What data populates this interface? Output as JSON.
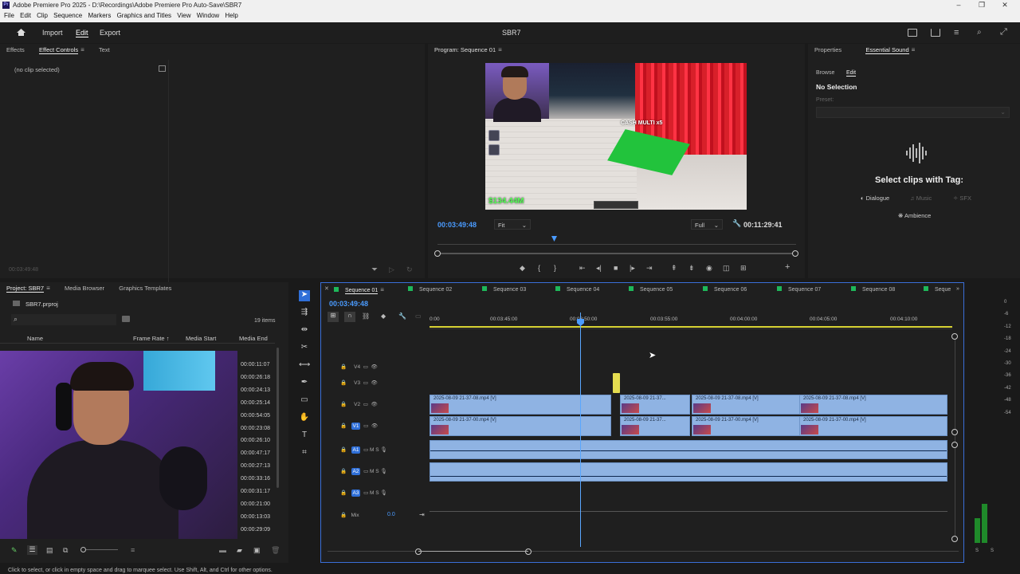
{
  "window": {
    "title": "Adobe Premiere Pro 2025 - D:\\Recordings\\Adobe Premiere Pro Auto-Save\\SBR7",
    "logo_text": "Pr"
  },
  "menu": [
    "File",
    "Edit",
    "Clip",
    "Sequence",
    "Markers",
    "Graphics and Titles",
    "View",
    "Window",
    "Help"
  ],
  "appbar": {
    "import": "Import",
    "edit": "Edit",
    "export": "Export",
    "project_title": "SBR7"
  },
  "effects_panel": {
    "tabs": [
      "Effects",
      "Effect Controls",
      "Text"
    ],
    "no_clip": "(no clip selected)",
    "timecode": "00:03:49:48"
  },
  "program": {
    "title": "Program: Sequence 01",
    "current_tc": "00:03:49:48",
    "fit": "Fit",
    "quality": "Full",
    "duration_tc": "00:11:29:41",
    "overlay_money": "$134.44M",
    "overlay_cash": "CASH MULTI x5"
  },
  "essential_sound": {
    "tabs": [
      "Properties",
      "Essential Sound"
    ],
    "subtabs": [
      "Browse",
      "Edit"
    ],
    "no_selection": "No Selection",
    "preset_label": "Preset:",
    "select_tag": "Select clips with Tag:",
    "tags": [
      "Dialogue",
      "Music",
      "SFX",
      "Ambience"
    ]
  },
  "project": {
    "tabs": [
      "Project: SBR7",
      "Media Browser",
      "Graphics Templates"
    ],
    "file": "SBR7.prproj",
    "items": "19 items",
    "columns": [
      "Name",
      "Frame Rate",
      "Media Start",
      "Media End"
    ],
    "media_end": [
      "00:00:11:07",
      "00:00:26:18",
      "00:00:24:13",
      "00:00:25:14",
      "00:00:54:05",
      "00:00:23:08",
      "00:00:26:10",
      "00:00:47:17",
      "00:00:27:13",
      "00:00:33:16",
      "00:00:31:17",
      "00:00:21:00",
      "00:00:13:03",
      "00:00:29:09"
    ]
  },
  "timeline": {
    "sequences": [
      "Sequence 01",
      "Sequence 02",
      "Sequence 03",
      "Sequence 04",
      "Sequence 05",
      "Sequence 06",
      "Sequence 07",
      "Sequence 08",
      "Seque"
    ],
    "timecode": "00:03:49:48",
    "ruler": [
      "0:00",
      "00:03:45:00",
      "00:03:50:00",
      "00:03:55:00",
      "00:04:00:00",
      "00:04:05:00",
      "00:04:10:00"
    ],
    "tracks": [
      "V4",
      "V3",
      "V2",
      "V1",
      "A1",
      "A2",
      "A3",
      "Mix"
    ],
    "mix_value": "0.0",
    "clip_v2": "2025-08-09 21-37-08.mp4 [V]",
    "clip_v2_short": "2025-08-09 21-37...",
    "clip_v1": "2025-08-09 21-37-00.mp4 [V]",
    "clip_v1_short": "2025-08-09 21-37..."
  },
  "meters": [
    "0",
    "-6",
    "-12",
    "-18",
    "-24",
    "-30",
    "-36",
    "-42",
    "-48",
    "-54"
  ],
  "meter_levels": {
    "left": 0.1,
    "right": 0.16
  },
  "status": "Click to select, or click in empty space and drag to marquee select. Use Shift, Alt, and Ctrl for other options."
}
